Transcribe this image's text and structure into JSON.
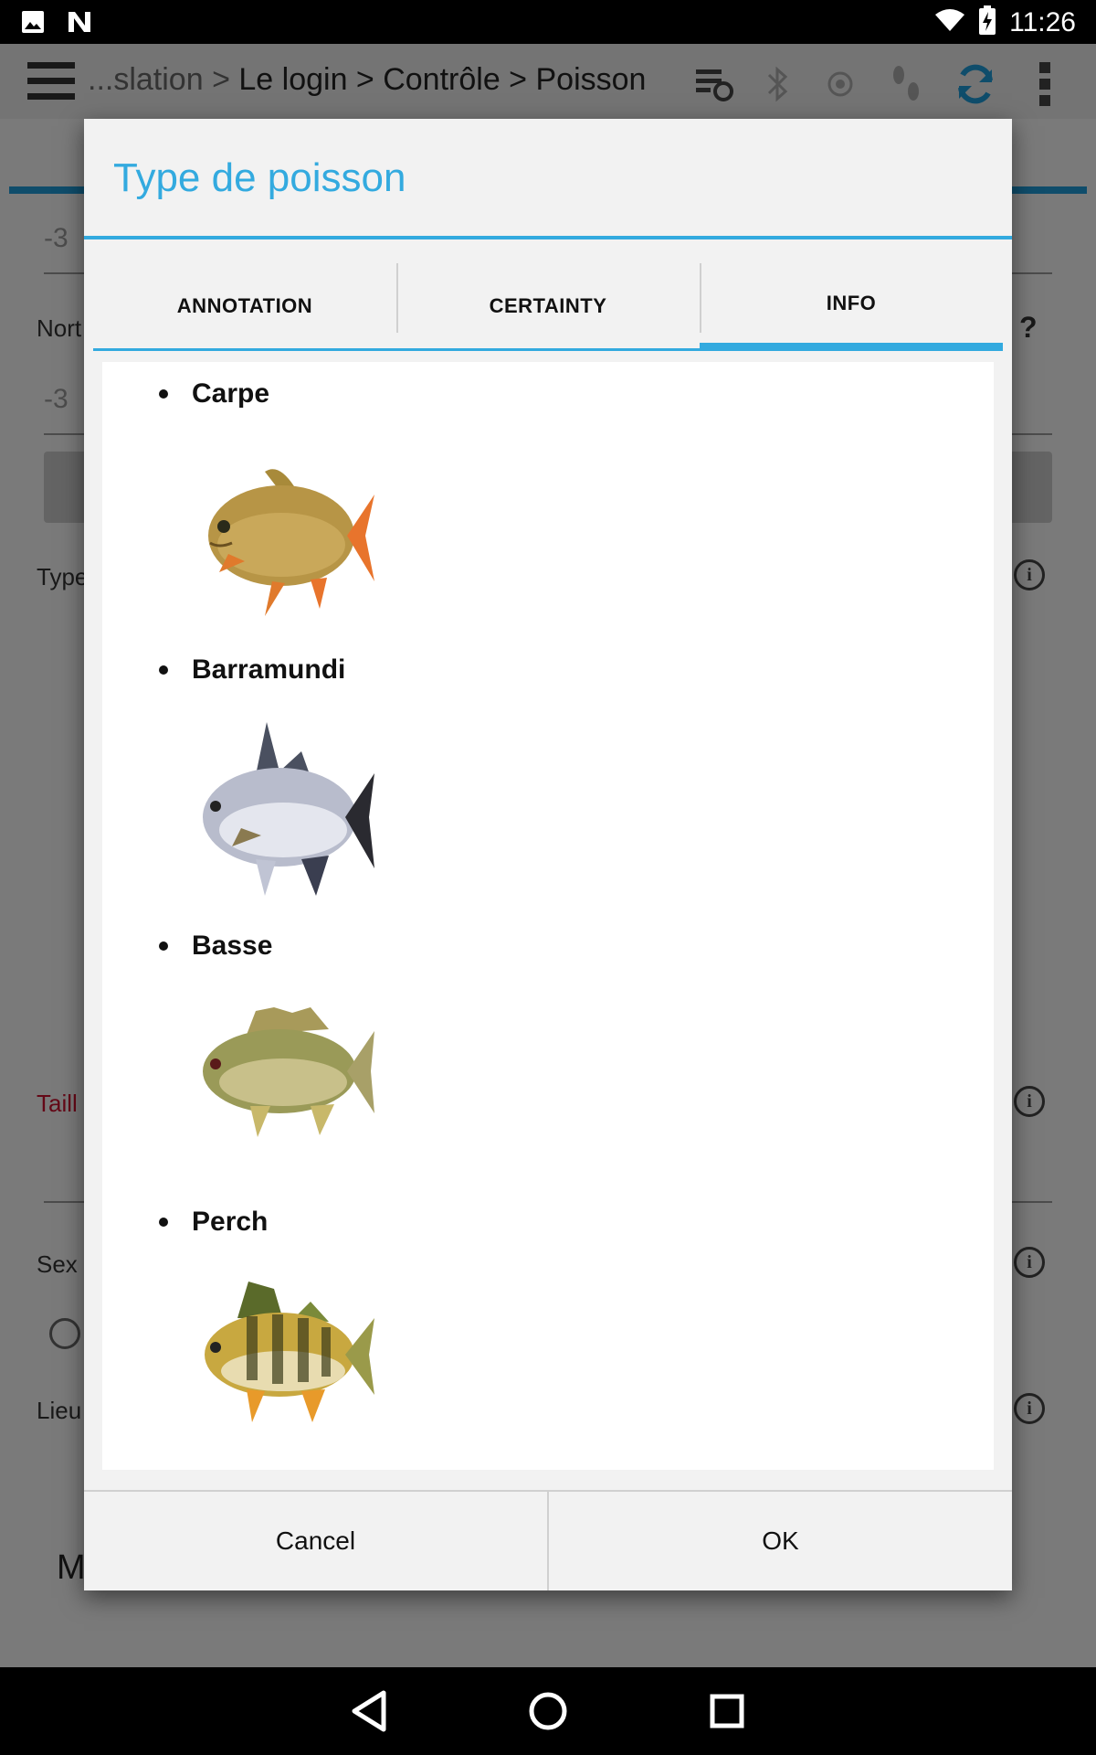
{
  "status_bar": {
    "time": "11:26",
    "left_icons": [
      "image-icon",
      "n-logo-icon"
    ],
    "right_icons": [
      "wifi-icon",
      "battery-charging-icon"
    ]
  },
  "toolbar": {
    "breadcrumb_prefix": "...slation > ",
    "breadcrumb_path": "Le login > Contrôle > Poisson",
    "icons": [
      "menu-icon",
      "sync-settings-icon",
      "bluetooth-icon",
      "gps-icon",
      "footsteps-icon",
      "refresh-icon",
      "overflow-menu-icon"
    ]
  },
  "background_form": {
    "field1_value": "-3",
    "north_label": "Nort",
    "field2_value": "-3",
    "type_label": "Type",
    "size_label": "Taill",
    "sex_label": "Sex",
    "place_label": "Lieu",
    "bottom_label": "M",
    "help_mark": "?"
  },
  "dialog": {
    "title": "Type de poisson",
    "tabs": [
      {
        "label": "ANNOTATION",
        "active": false
      },
      {
        "label": "CERTAINTY",
        "active": false
      },
      {
        "label": "INFO",
        "active": true
      }
    ],
    "fish": [
      {
        "name": "Carpe",
        "image": "carp-image"
      },
      {
        "name": "Barramundi",
        "image": "barramundi-image"
      },
      {
        "name": "Basse",
        "image": "bass-image"
      },
      {
        "name": "Perch",
        "image": "perch-image"
      }
    ],
    "cancel_label": "Cancel",
    "ok_label": "OK"
  },
  "colors": {
    "accent": "#33aadf",
    "dialog_bg": "#f2f2f2",
    "status_bar": "#000000",
    "required_label": "#c8102e"
  },
  "nav_bar": {
    "icons": [
      "back-icon",
      "home-icon",
      "recents-icon"
    ]
  }
}
